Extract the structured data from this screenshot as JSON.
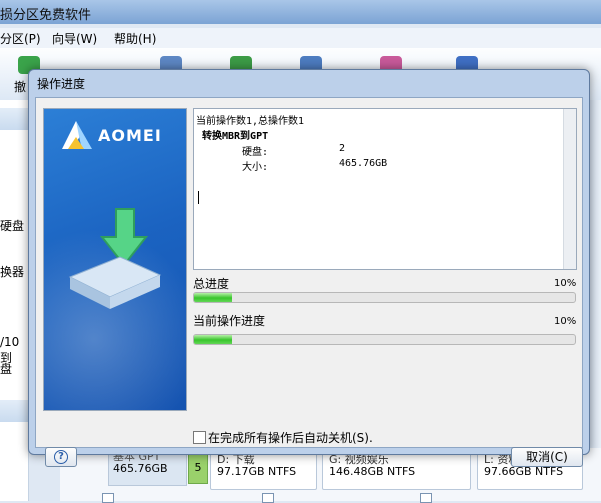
{
  "app": {
    "title": "损分区免费软件",
    "menu": [
      "分区(P)",
      "向导(W)",
      "帮助(H)"
    ],
    "toolbar_first_label": "撤",
    "side_items": [
      "硬盘",
      "换器",
      "/10到",
      "盘"
    ],
    "disks": [
      {
        "head": "基本 GPT",
        "size": "465.76GB"
      },
      {
        "seg": "5"
      },
      {
        "head": "D: 下载",
        "size": "97.17GB NTFS"
      },
      {
        "head": "G: 视频娱乐",
        "size": "146.48GB NTFS"
      },
      {
        "head": "L: 资料文件",
        "size": "97.66GB NTFS"
      }
    ]
  },
  "dialog": {
    "title": "操作进度",
    "brand": "AOMEI",
    "log": {
      "line1": "当前操作数1,总操作数1",
      "line2": "转换MBR到GPT",
      "disk_label": "硬盘:",
      "disk_value": "2",
      "size_label": "大小:",
      "size_value": "465.76GB"
    },
    "total_progress": {
      "label": "总进度",
      "percent_text": "10%",
      "fraction": 0.1
    },
    "current_progress": {
      "label": "当前操作进度",
      "percent_text": "10%",
      "fraction": 0.1
    },
    "shutdown_checkbox": {
      "label": "在完成所有操作后自动关机(S).",
      "checked": false
    },
    "help_label": "?",
    "cancel_label": "取消(C)"
  },
  "colors": {
    "brand_blue": "#1b63c1",
    "progress_green": "#39c52c"
  }
}
